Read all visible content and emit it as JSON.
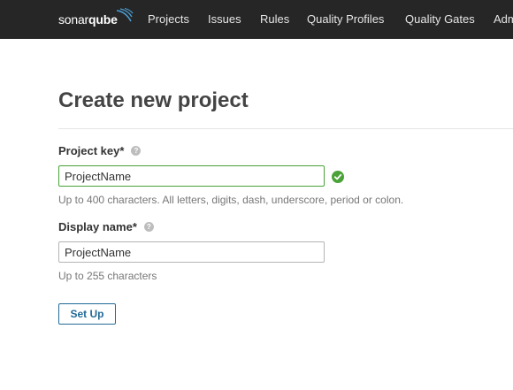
{
  "navbar": {
    "logo_part1": "sonar",
    "logo_part2": "qube",
    "items": [
      {
        "label": "Projects"
      },
      {
        "label": "Issues"
      },
      {
        "label": "Rules"
      },
      {
        "label": "Quality Profiles"
      },
      {
        "label": "Quality Gates"
      },
      {
        "label": "Administration"
      }
    ]
  },
  "page": {
    "title": "Create new project"
  },
  "form": {
    "project_key": {
      "label": "Project key*",
      "value": "ProjectName",
      "hint": "Up to 400 characters. All letters, digits, dash, underscore, period or colon.",
      "help_icon": "question-circle-icon",
      "status_icon": "check-circle-icon"
    },
    "display_name": {
      "label": "Display name*",
      "value": "ProjectName",
      "hint": "Up to 255 characters",
      "help_icon": "question-circle-icon"
    },
    "submit_label": "Set Up"
  },
  "colors": {
    "navbar_bg": "#262626",
    "valid_green": "#4aa238",
    "button_blue": "#236a97"
  }
}
